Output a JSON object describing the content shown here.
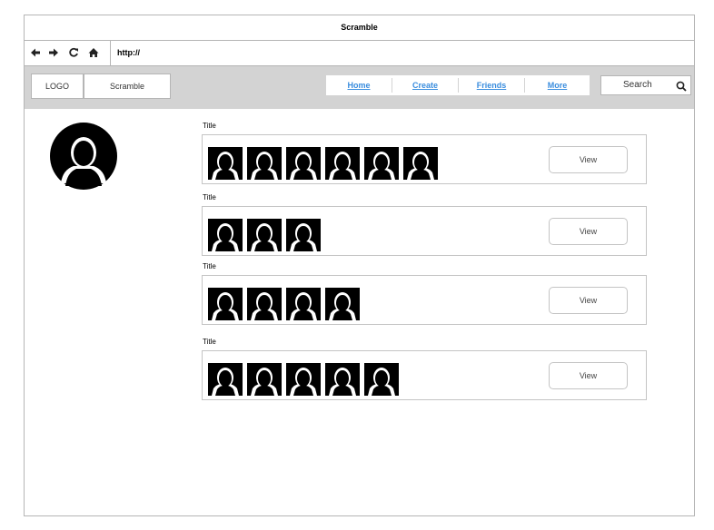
{
  "window": {
    "title": "Scramble"
  },
  "browser": {
    "url": "http://",
    "icons": [
      "back-arrow-icon",
      "forward-arrow-icon",
      "refresh-icon",
      "home-icon"
    ]
  },
  "header": {
    "logo": "LOGO",
    "app_name": "Scramble",
    "nav": [
      "Home",
      "Create",
      "Friends",
      "More"
    ],
    "search_label": "Search",
    "link_color": "#3a8dde",
    "bar_color": "#d3d3d3"
  },
  "sections": [
    {
      "title": "Title",
      "thumbnail_count": 6,
      "button": "View"
    },
    {
      "title": "Title",
      "thumbnail_count": 3,
      "button": "View"
    },
    {
      "title": "Title",
      "thumbnail_count": 4,
      "button": "View"
    },
    {
      "title": "Title",
      "thumbnail_count": 5,
      "button": "View"
    }
  ]
}
